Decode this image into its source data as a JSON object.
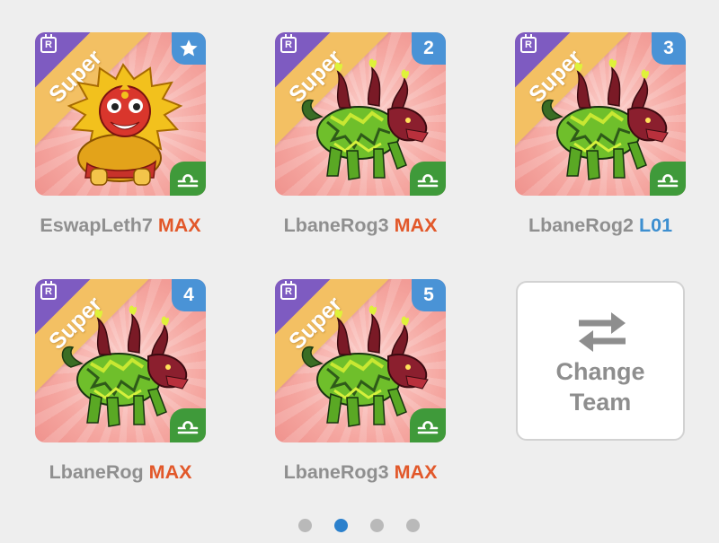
{
  "cards": [
    {
      "rarity": "Super",
      "rank_badge": "R",
      "slot_label": "★",
      "slot_icon": "star-icon",
      "name": "EswapLeth7",
      "level": "MAX",
      "level_kind": "max",
      "creature": "lion-dog-yellow",
      "element_icon": "libra-icon"
    },
    {
      "rarity": "Super",
      "rank_badge": "R",
      "slot_label": "2",
      "slot_icon": "",
      "name": "LbaneRog3",
      "level": "MAX",
      "level_kind": "max",
      "creature": "qilin-green",
      "element_icon": "libra-icon"
    },
    {
      "rarity": "Super",
      "rank_badge": "R",
      "slot_label": "3",
      "slot_icon": "",
      "name": "LbaneRog2",
      "level": "L01",
      "level_kind": "low",
      "creature": "qilin-green",
      "element_icon": "libra-icon"
    },
    {
      "rarity": "Super",
      "rank_badge": "R",
      "slot_label": "4",
      "slot_icon": "",
      "name": "LbaneRog",
      "level": "MAX",
      "level_kind": "max",
      "creature": "qilin-green",
      "element_icon": "libra-icon"
    },
    {
      "rarity": "Super",
      "rank_badge": "R",
      "slot_label": "5",
      "slot_icon": "",
      "name": "LbaneRog3",
      "level": "MAX",
      "level_kind": "max",
      "creature": "qilin-green",
      "element_icon": "libra-icon"
    }
  ],
  "change_team": {
    "line1": "Change",
    "line2": "Team",
    "icon": "swap-arrows-icon"
  },
  "pagination": {
    "count": 4,
    "active_index": 1
  },
  "colors": {
    "level_max": "#e2582a",
    "level_low": "#3d8fd0",
    "rarity_band": "#f3c063",
    "rank_corner": "#7e5bc1",
    "slot_tab": "#4a93d6",
    "element_tab": "#3f9a3a",
    "dot_active": "#2b80cc",
    "dot_inactive": "#b9b9b9"
  }
}
